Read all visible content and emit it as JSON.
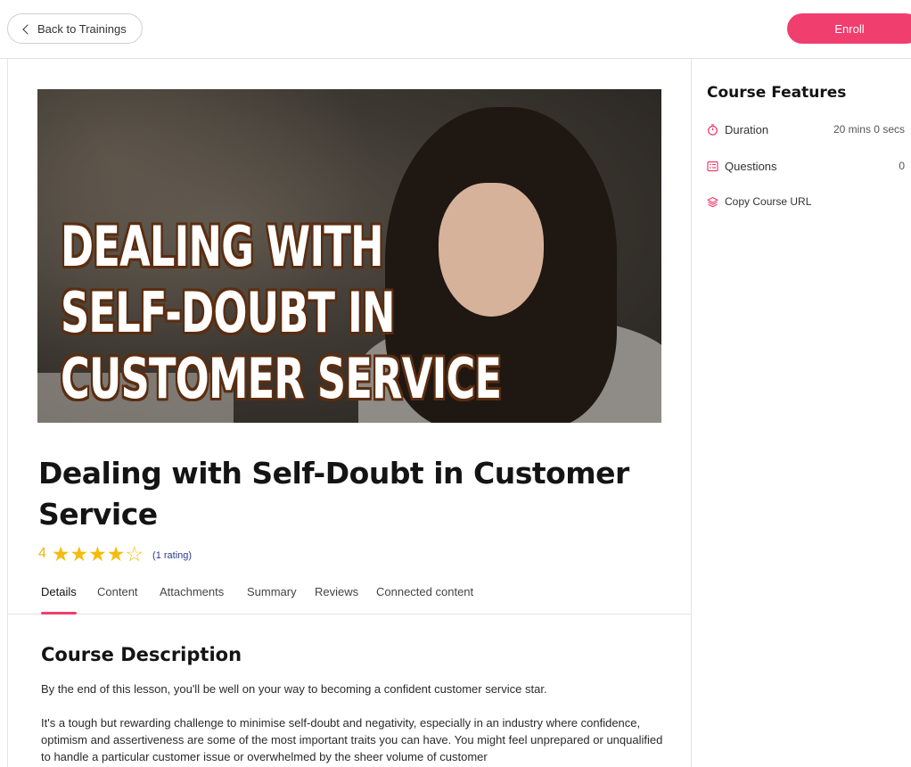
{
  "topbar": {
    "back_label": "Back to Trainings",
    "enroll_label": "Enroll"
  },
  "hero": {
    "line1": "DEALING WITH",
    "line2": "SELF-DOUBT IN",
    "line3": "CUSTOMER SERVICE"
  },
  "course": {
    "title": "Dealing with Self-Doubt in Customer Service",
    "rating_value": "4",
    "rating_stars": 4,
    "rating_max": 5,
    "rating_count": "(1 rating)"
  },
  "tabs": [
    {
      "label": "Details",
      "active": true
    },
    {
      "label": "Content",
      "active": false
    },
    {
      "label": "Attachments",
      "active": false
    },
    {
      "label": "Summary",
      "active": false
    },
    {
      "label": "Reviews",
      "active": false
    },
    {
      "label": "Connected content",
      "active": false
    }
  ],
  "description": {
    "title": "Course Description",
    "p1": "By the end of this lesson, you'll be well on your way to becoming a confident customer service star.",
    "p2": "It's a tough but rewarding challenge to minimise self-doubt and negativity, especially in an industry where confidence, optimism and assertiveness are some of the most important traits you can have. You might feel unprepared or unqualified to handle a particular customer issue or overwhelmed by the sheer volume of customer"
  },
  "features": {
    "title": "Course Features",
    "duration_label": "Duration",
    "duration_value": "20 mins 0 secs",
    "questions_label": "Questions",
    "questions_value": "0",
    "copy_url_label": "Copy Course URL"
  },
  "colors": {
    "accent": "#f03e6e",
    "star": "#f5bc0d",
    "rating_count": "#2a3990"
  },
  "icons": {
    "back": "chevron-left-icon",
    "duration": "stopwatch-icon",
    "questions": "list-icon",
    "copy_url": "layers-icon",
    "star": "star-icon"
  }
}
